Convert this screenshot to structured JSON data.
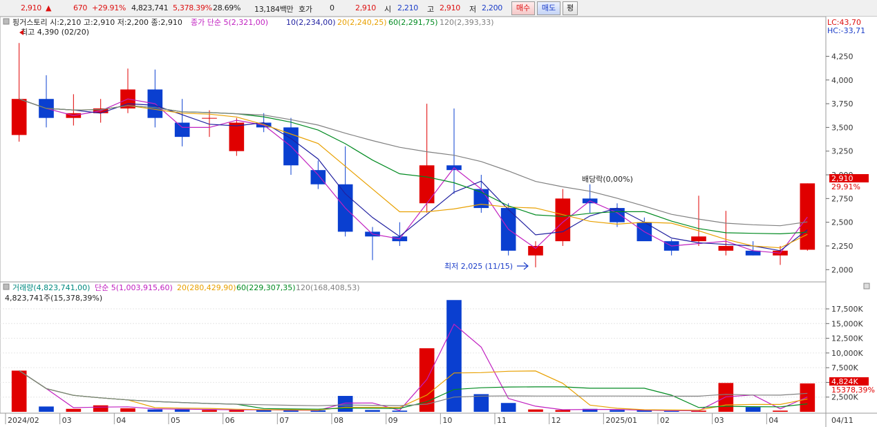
{
  "quote": {
    "price": "2,910",
    "change": "670",
    "change_pct": "+29.91%",
    "volume": "4,823,741",
    "volume_ratio": "5,378.39%",
    "turnover": "28.69%",
    "amount": "13,184백만",
    "hoga_label": "호가",
    "hoga_value": "0",
    "ask_price": "2,910",
    "open_label": "시",
    "open": "2,210",
    "high_label": "고",
    "high": "2,910",
    "low_label": "저",
    "low": "2,200",
    "buy_label": "매수",
    "sell_label": "매도",
    "eval_label": "평"
  },
  "colors": {
    "up": "#e00000",
    "down": "#0a3fd0",
    "ma5": "#c020c0",
    "ma10": "#2020a0",
    "ma20": "#e8a000",
    "ma60": "#008a20",
    "ma120": "#808080",
    "vol": "#008a80"
  },
  "price_panel": {
    "info": "핑거스토리 시:2,210 고:2,910 저:2,200 종:2,910",
    "ma_legend": [
      {
        "label": "종가 단순 5(2,321,00)",
        "color": "#c020c0"
      },
      {
        "label": "10(2,234,00)",
        "color": "#2020a0"
      },
      {
        "label": "20(2,240,25)",
        "color": "#e8a000"
      },
      {
        "label": "60(2,291,75)",
        "color": "#008a20"
      },
      {
        "label": "120(2,393,33)",
        "color": "#808080"
      }
    ],
    "high_annot": "최고 4,390 (02/20)",
    "low_annot": "최저 2,025 (11/15)",
    "dividend_annot": "배당락(0,00%)",
    "lc": "LC:43,70",
    "hc": "HC:-33,71",
    "last_tag": "2,910",
    "last_pct_tag": "29,91%",
    "y_ticks": [
      "4,250",
      "4,000",
      "3,750",
      "3,500",
      "3,250",
      "3,000",
      "2,750",
      "2,500",
      "2,250",
      "2,000"
    ]
  },
  "volume_panel": {
    "legend": [
      {
        "label": "거래량(4,823,741,00)",
        "color": "#008a80"
      },
      {
        "label": "단순 5(1,003,915,60)",
        "color": "#c020c0"
      },
      {
        "label": "20(280,429,90)",
        "color": "#e8a000"
      },
      {
        "label": "60(229,307,35)",
        "color": "#008a20"
      },
      {
        "label": "120(168,408,53)",
        "color": "#808080"
      }
    ],
    "sub": "4,823,741주(15,378,39%)",
    "y_ticks": [
      "17,500K",
      "15,000K",
      "12,500K",
      "10,000K",
      "7,500K",
      "5,000K",
      "2,500K"
    ],
    "last_tag": "4,824K",
    "last_pct_tag": "15378,39%"
  },
  "x_axis": {
    "labels": [
      "2024/02",
      "03",
      "04",
      "05",
      "06",
      "07",
      "08",
      "09",
      "10",
      "11",
      "12",
      "2025/01",
      "02",
      "03",
      "04"
    ],
    "right_label": "04/11"
  },
  "chart_data": {
    "type": "candlestick",
    "x": [
      "2024/02",
      "2024/02",
      "2024/03",
      "2024/03",
      "2024/04",
      "2024/04",
      "2024/05",
      "2024/05",
      "2024/06",
      "2024/06",
      "2024/07",
      "2024/07",
      "2024/08",
      "2024/08",
      "2024/09",
      "2024/09",
      "2024/10",
      "2024/10",
      "2024/11",
      "2024/11",
      "2024/12",
      "2024/12",
      "2025/01",
      "2025/01",
      "2025/02",
      "2025/02",
      "2025/03",
      "2025/03",
      "2025/04",
      "2025/04"
    ],
    "open": [
      3420,
      3800,
      3600,
      3650,
      3700,
      3900,
      3550,
      3600,
      3250,
      3550,
      3500,
      3050,
      2900,
      2400,
      2350,
      2700,
      3100,
      2850,
      2650,
      2150,
      2300,
      2750,
      2650,
      2500,
      2300,
      2300,
      2200,
      2200,
      2150,
      2210
    ],
    "high": [
      4390,
      4050,
      3850,
      3800,
      4120,
      4110,
      3800,
      3680,
      3600,
      3650,
      3600,
      3150,
      3300,
      2450,
      2500,
      3750,
      3700,
      3000,
      2700,
      2300,
      2850,
      2900,
      2700,
      2550,
      2320,
      2780,
      2620,
      2300,
      2250,
      2910
    ],
    "low": [
      3350,
      3500,
      3520,
      3550,
      3650,
      3500,
      3300,
      3400,
      3200,
      3450,
      3000,
      2850,
      2350,
      2100,
      2250,
      2600,
      2800,
      2600,
      2150,
      2025,
      2250,
      2600,
      2450,
      2350,
      2150,
      2250,
      2150,
      2150,
      2050,
      2200
    ],
    "close": [
      3800,
      3600,
      3650,
      3700,
      3900,
      3600,
      3400,
      3600,
      3550,
      3500,
      3100,
      2900,
      2400,
      2350,
      2300,
      3100,
      3050,
      2650,
      2200,
      2250,
      2750,
      2700,
      2500,
      2300,
      2200,
      2350,
      2250,
      2150,
      2200,
      2910
    ],
    "volume": [
      7000000,
      900000,
      500000,
      1100000,
      600000,
      400000,
      500000,
      300000,
      350000,
      300000,
      250000,
      250000,
      2700000,
      300000,
      200000,
      10800000,
      19000000,
      3000000,
      1500000,
      400000,
      300000,
      500000,
      300000,
      250000,
      150000,
      200000,
      4900000,
      800000,
      200000,
      4823741
    ],
    "ylim": [
      1900,
      4450
    ],
    "volume_ylim": [
      0,
      19500000
    ]
  }
}
